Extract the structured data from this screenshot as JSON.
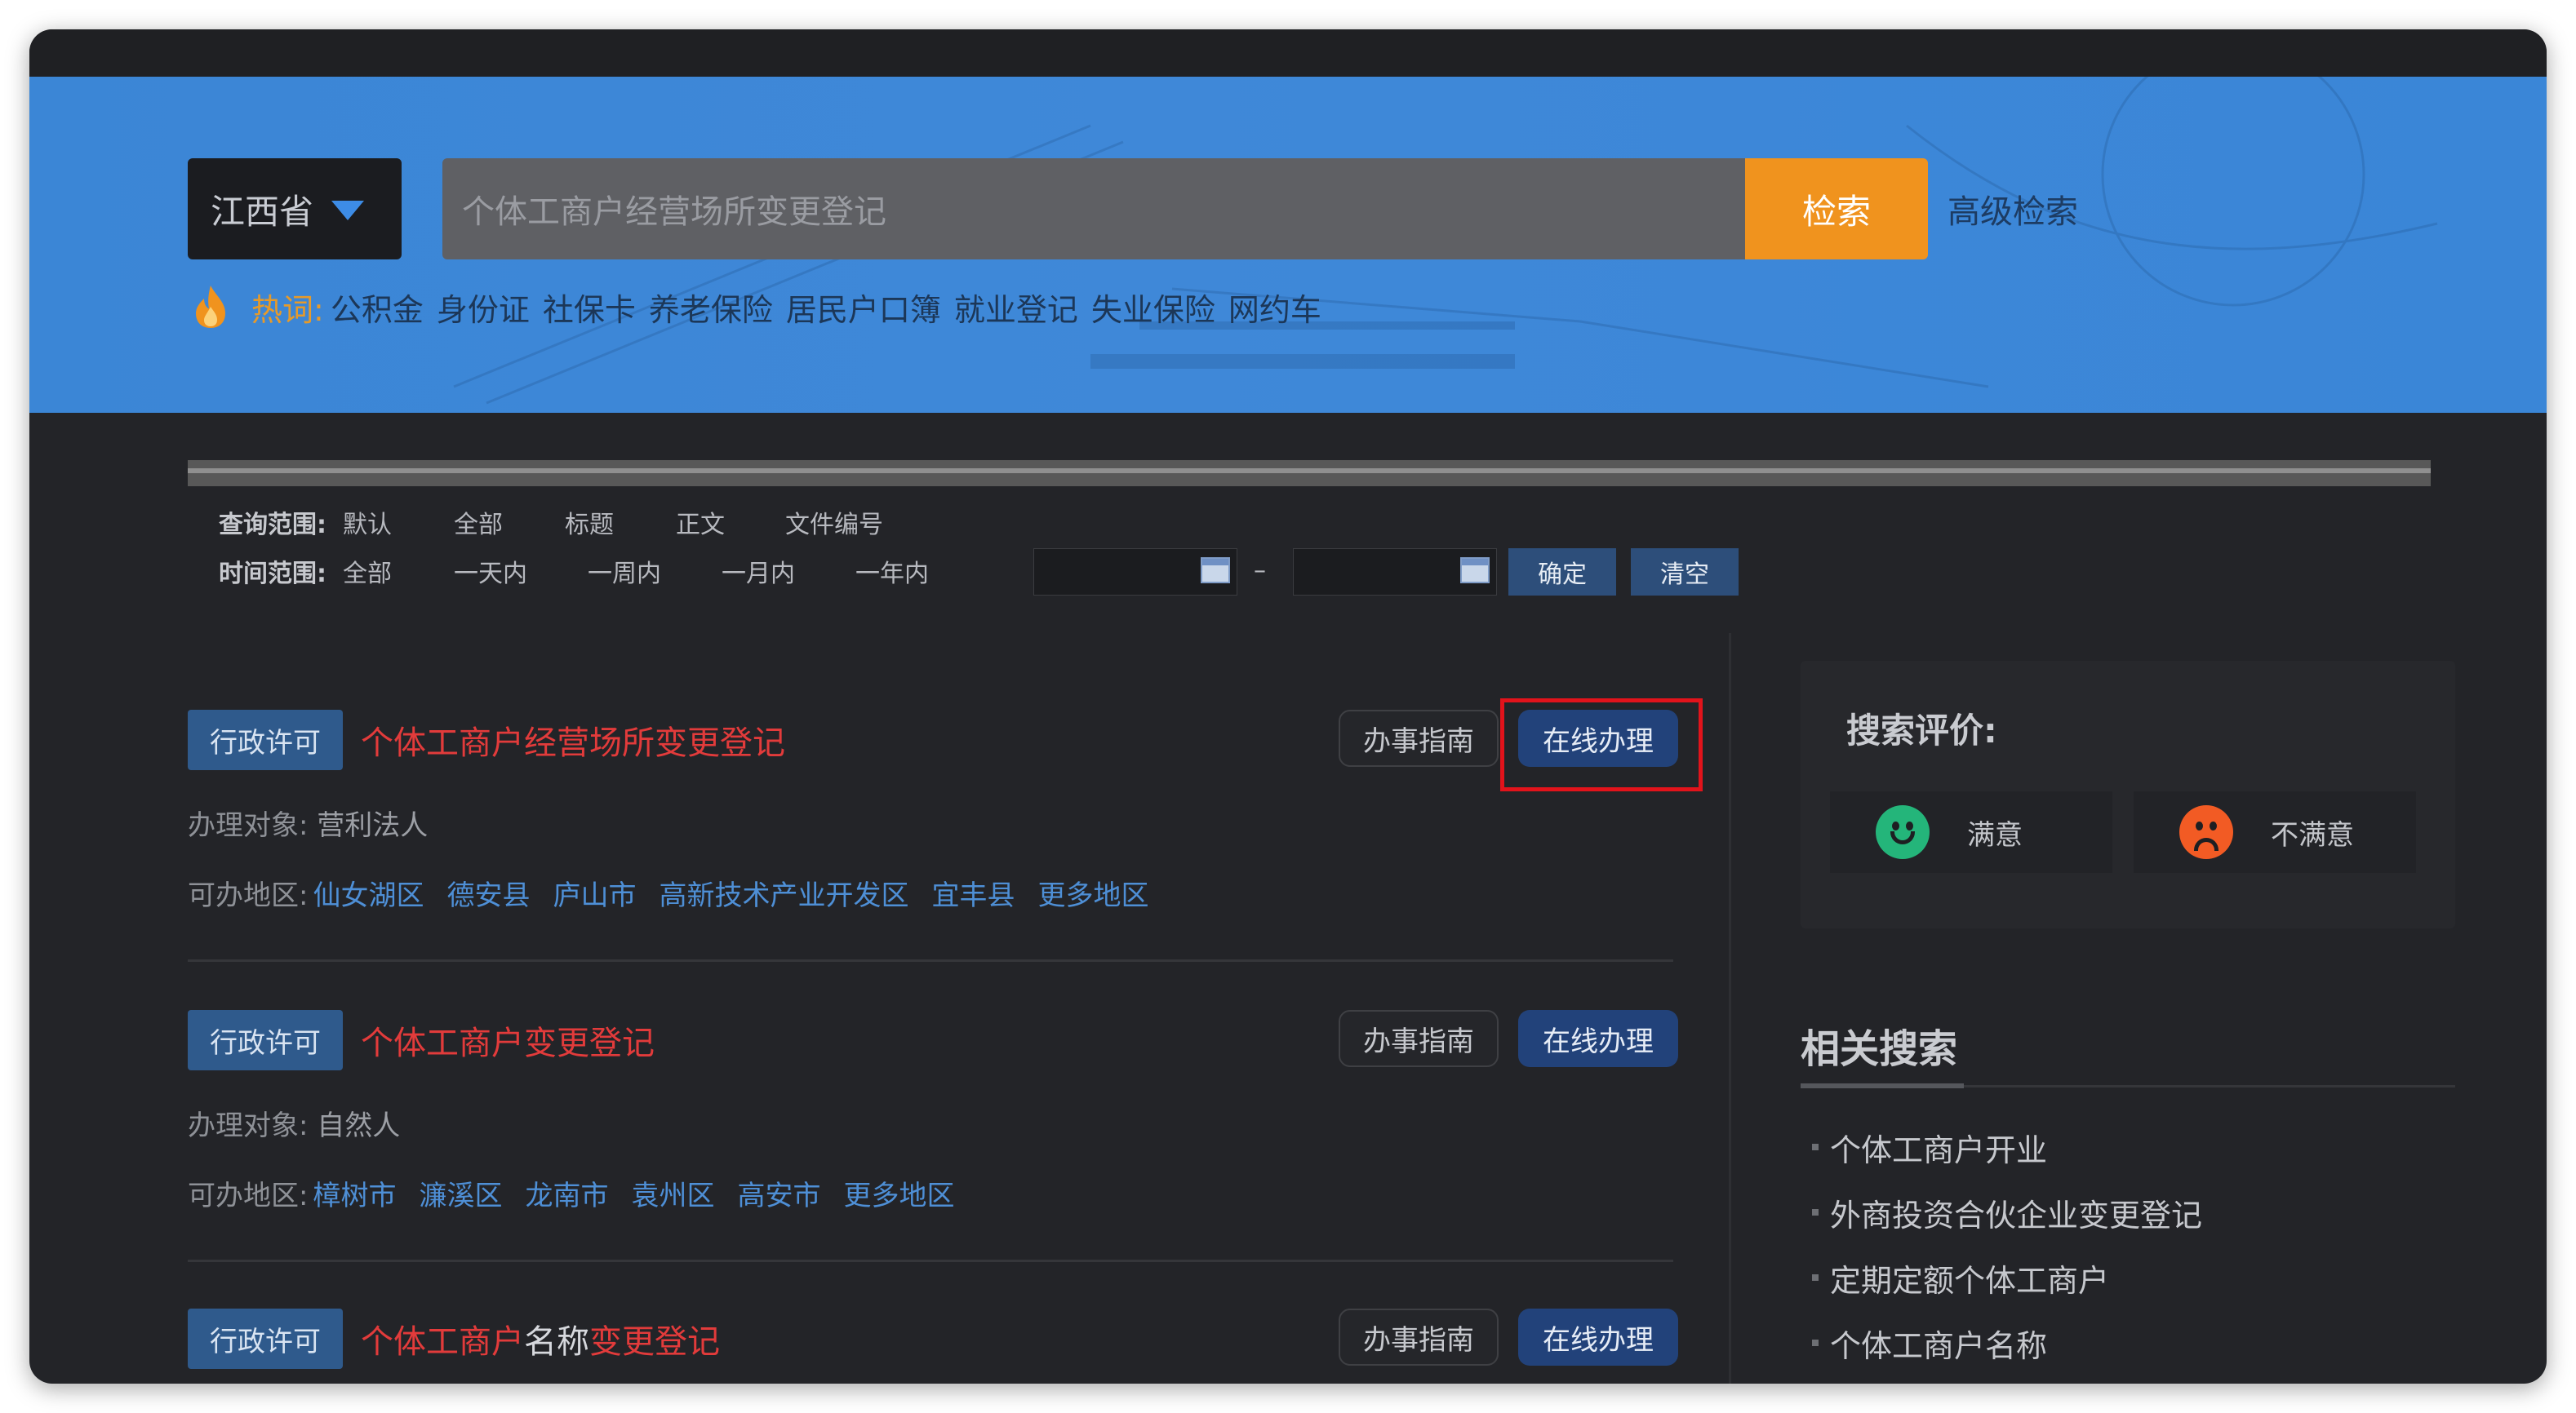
{
  "search": {
    "province": "江西省",
    "query": "个体工商户经营场所变更登记",
    "button": "检索",
    "advanced": "高级检索"
  },
  "hotwords": {
    "label": "热词:",
    "items": [
      "公积金",
      "身份证",
      "社保卡",
      "养老保险",
      "居民户口簿",
      "就业登记",
      "失业保险",
      "网约车"
    ]
  },
  "filters": {
    "scope_label": "查询范围:",
    "scope_options": [
      "默认",
      "全部",
      "标题",
      "正文",
      "文件编号"
    ],
    "time_label": "时间范围:",
    "time_options": [
      "全部",
      "一天内",
      "一周内",
      "一月内",
      "一年内"
    ],
    "dash": "–",
    "confirm": "确定",
    "clear": "清空"
  },
  "results": [
    {
      "tag": "行政许可",
      "title_parts": [
        {
          "text": "个体工商户经营场所变更登记",
          "hl": true
        }
      ],
      "guide": "办事指南",
      "online": "在线办理",
      "obj_label": "办理对象:",
      "obj_value": "营利法人",
      "areas_label": "可办地区:",
      "areas": [
        "仙女湖区",
        "德安县",
        "庐山市",
        "高新技术产业开发区",
        "宜丰县",
        "更多地区"
      ]
    },
    {
      "tag": "行政许可",
      "title_parts": [
        {
          "text": "个体工商户变更登记",
          "hl": true
        }
      ],
      "guide": "办事指南",
      "online": "在线办理",
      "obj_label": "办理对象:",
      "obj_value": "自然人",
      "areas_label": "可办地区:",
      "areas": [
        "樟树市",
        "濂溪区",
        "龙南市",
        "袁州区",
        "高安市",
        "更多地区"
      ]
    },
    {
      "tag": "行政许可",
      "title_parts": [
        {
          "text": "个体工商户",
          "hl": true
        },
        {
          "text": "名称",
          "hl": false
        },
        {
          "text": "变更登记",
          "hl": true
        }
      ],
      "guide": "办事指南",
      "online": "在线办理"
    }
  ],
  "evaluation": {
    "title": "搜索评价:",
    "good": "满意",
    "bad": "不满意"
  },
  "related": {
    "title": "相关搜索",
    "items": [
      "个体工商户开业",
      "外商投资合伙企业变更登记",
      "定期定额个体工商户",
      "个体工商户名称"
    ]
  },
  "colors": {
    "banner": "#3b86d6",
    "search_button": "#f0931e",
    "highlight_text": "#e23b3b",
    "link": "#4e8fd6",
    "annotation_box": "#e2131b"
  }
}
